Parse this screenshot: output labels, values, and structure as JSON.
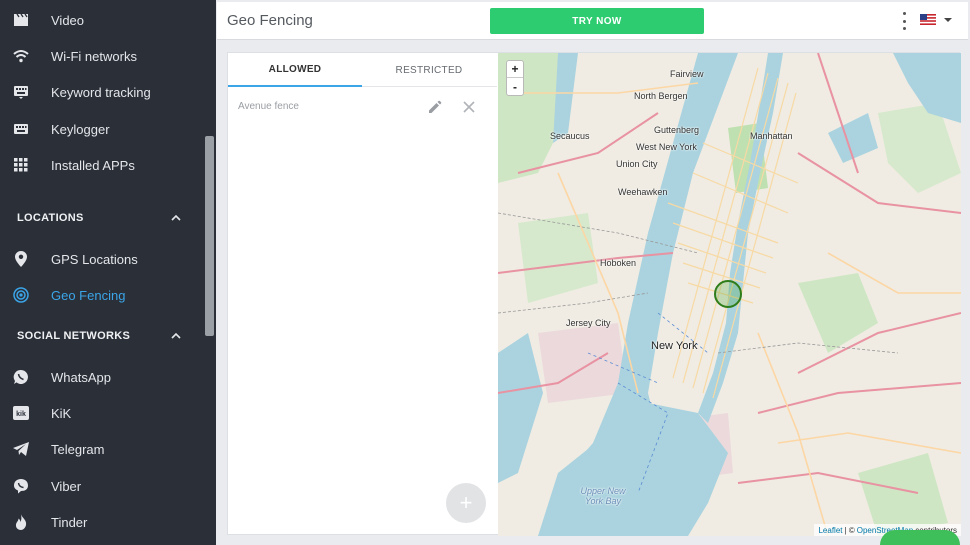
{
  "sidebar": {
    "items_top": [
      {
        "label": "Video",
        "icon": "video-clapper-icon"
      },
      {
        "label": "Wi-Fi networks",
        "icon": "wifi-icon"
      },
      {
        "label": "Keyword tracking",
        "icon": "keyboard-icon"
      },
      {
        "label": "Keylogger",
        "icon": "keyboard-icon"
      },
      {
        "label": "Installed APPs",
        "icon": "grid-icon"
      }
    ],
    "locations_section": "LOCATIONS",
    "locations_items": [
      {
        "label": "GPS Locations",
        "icon": "location-pin-icon"
      },
      {
        "label": "Geo Fencing",
        "icon": "geofence-target-icon"
      }
    ],
    "social_section": "SOCIAL NETWORKS",
    "social_items": [
      {
        "label": "WhatsApp",
        "icon": "whatsapp-icon"
      },
      {
        "label": "KiK",
        "icon": "kik-icon"
      },
      {
        "label": "Telegram",
        "icon": "telegram-icon"
      },
      {
        "label": "Viber",
        "icon": "viber-icon"
      },
      {
        "label": "Tinder",
        "icon": "tinder-flame-icon"
      }
    ]
  },
  "header": {
    "title": "Geo Fencing",
    "cta_label": "TRY NOW"
  },
  "tabs": [
    "ALLOWED",
    "RESTRICTED"
  ],
  "fences": [
    {
      "name": "Avenue fence"
    }
  ],
  "fab_label": "+",
  "map": {
    "zoom_in": "+",
    "zoom_out": "-",
    "attribution_leaflet": "Leaflet",
    "attribution_sep": " | © ",
    "attribution_osm": "OpenStreetMap",
    "attribution_rest": "contributors",
    "labels": [
      "Fairview",
      "North Bergen",
      "Guttenberg",
      "Secaucus",
      "West New York",
      "Manhattan",
      "Union City",
      "Weehawken",
      "Hoboken",
      "Jersey City",
      "New York",
      "Upper New York Bay"
    ]
  },
  "colors": {
    "sidebar_bg": "#2a2f38",
    "accent": "#3ba5e8",
    "cta": "#2ecc71"
  }
}
